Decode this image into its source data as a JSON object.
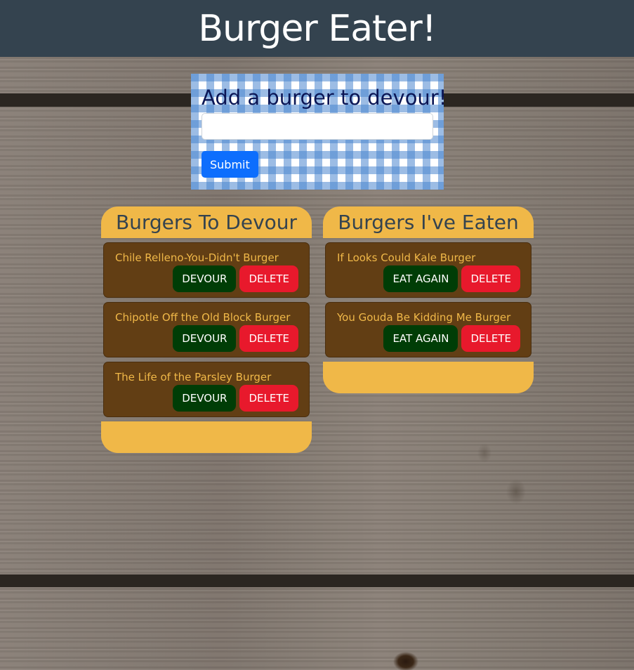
{
  "header": {
    "title": "Burger Eater!"
  },
  "add_form": {
    "heading": "Add a burger to devour!",
    "input_value": "",
    "input_placeholder": "",
    "submit_label": "Submit"
  },
  "to_devour": {
    "title": "Burgers To Devour",
    "action_label": "DEVOUR",
    "delete_label": "DELETE",
    "items": [
      {
        "name": "Chile Relleno-You-Didn't Burger"
      },
      {
        "name": "Chipotle Off the Old Block Burger"
      },
      {
        "name": "The Life of the Parsley Burger"
      }
    ]
  },
  "eaten": {
    "title": "Burgers I've Eaten",
    "action_label": "EAT AGAIN",
    "delete_label": "DELETE",
    "items": [
      {
        "name": "If Looks Could Kale Burger"
      },
      {
        "name": "You Gouda Be Kidding Me Burger"
      }
    ]
  },
  "colors": {
    "header_bg": "#34434f",
    "bun": "#f0b848",
    "patty": "#623e14",
    "action_button": "#003d06",
    "delete_button": "#e8192c",
    "submit_button": "#0d6efd"
  }
}
